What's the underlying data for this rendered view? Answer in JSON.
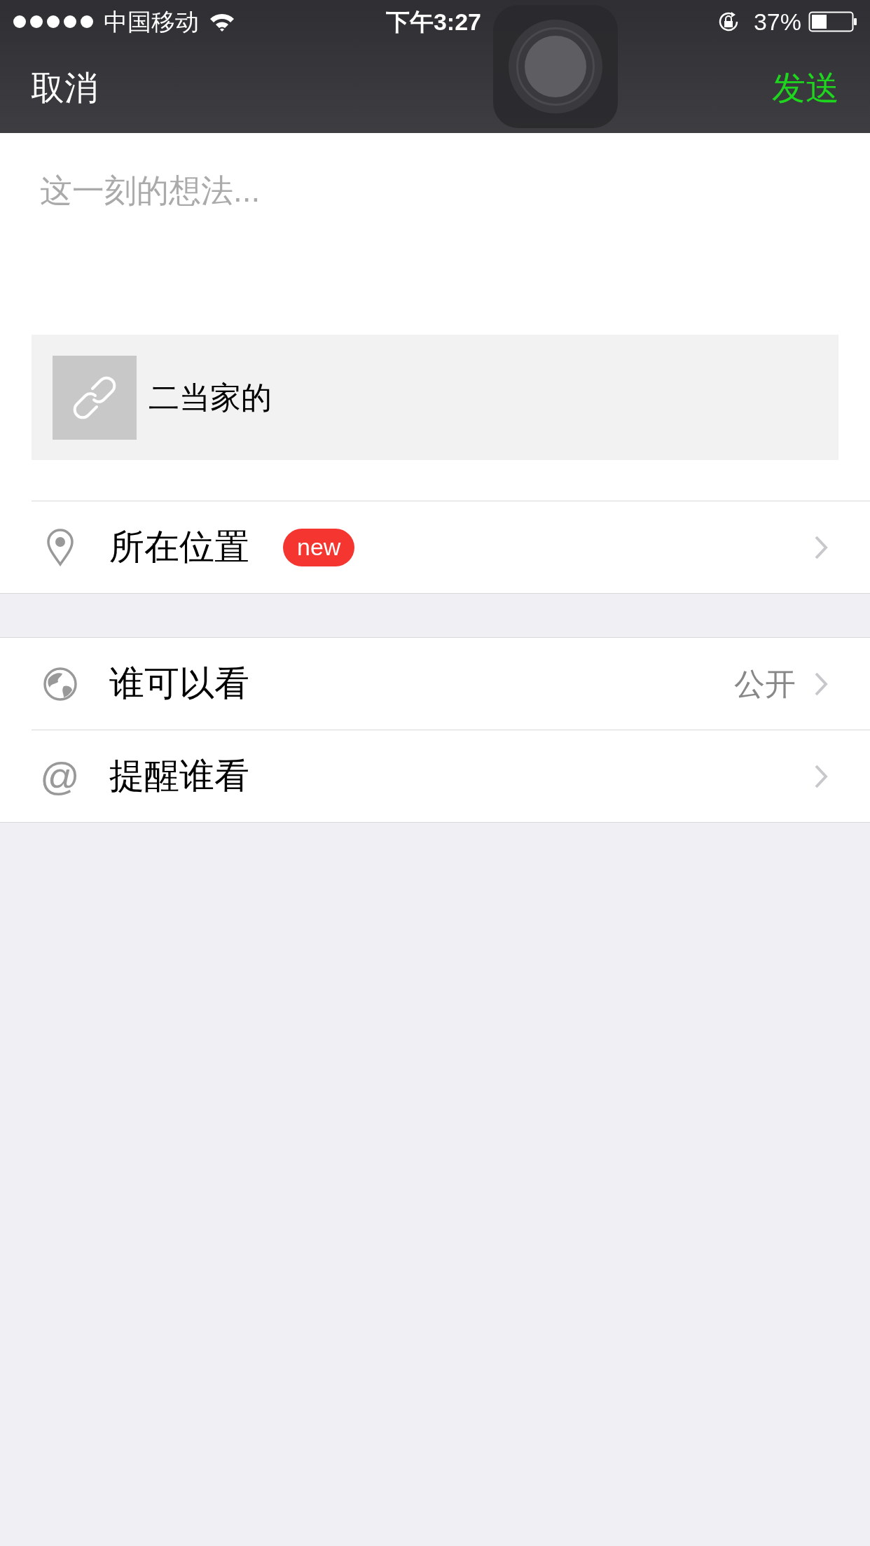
{
  "status_bar": {
    "carrier": "中国移动",
    "time": "下午3:27",
    "battery": "37%"
  },
  "nav": {
    "cancel": "取消",
    "send": "发送"
  },
  "composer": {
    "placeholder": "这一刻的想法..."
  },
  "link_card": {
    "title": "二当家的"
  },
  "sections": [
    [
      {
        "kind": "location",
        "label": "所在位置",
        "badge": "new"
      }
    ],
    [
      {
        "kind": "visibility",
        "label": "谁可以看",
        "value": "公开"
      },
      {
        "kind": "mention",
        "symbol": "@",
        "label": "提醒谁看"
      }
    ]
  ]
}
